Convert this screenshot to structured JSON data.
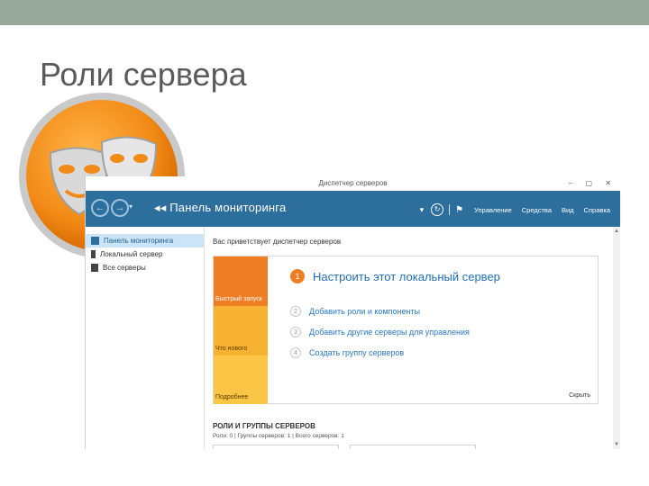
{
  "slide": {
    "title": "Роли сервера"
  },
  "window": {
    "title": "Диспетчер серверов",
    "controls": "– ▢ ✕"
  },
  "toolbar": {
    "back": "←",
    "forward": "→",
    "dropdown": "▾",
    "breadcrumb": "◂◂ Панель мониторинга",
    "refresh": "↻",
    "flag": "⚑",
    "menu": [
      "Управление",
      "Средства",
      "Вид",
      "Справка"
    ]
  },
  "sidebar": {
    "items": [
      {
        "label": "Панель мониторинга",
        "active": true
      },
      {
        "label": "Локальный сервер",
        "active": false
      },
      {
        "label": "Все серверы",
        "active": false
      }
    ]
  },
  "main": {
    "welcome": "Вас приветствует диспетчер серверов",
    "tiles": [
      "Быстрый запуск",
      "Что нового",
      "Подробнее"
    ],
    "steps": [
      {
        "num": "1",
        "label": "Настроить этот локальный сервер"
      },
      {
        "num": "2",
        "label": "Добавить роли и компоненты"
      },
      {
        "num": "3",
        "label": "Добавить другие серверы для управления"
      },
      {
        "num": "4",
        "label": "Создать группу серверов"
      }
    ],
    "hide": "Скрыть",
    "roles_heading": "РОЛИ И ГРУППЫ СЕРВЕРОВ",
    "roles_summary": "Роли: 0 | Группы серверов: 1 | Всего серверов: 1"
  },
  "colors": {
    "toolbar_bg": "#2c6e9c",
    "accent_orange": "#ef7d23",
    "link_blue": "#1f6fb5"
  }
}
